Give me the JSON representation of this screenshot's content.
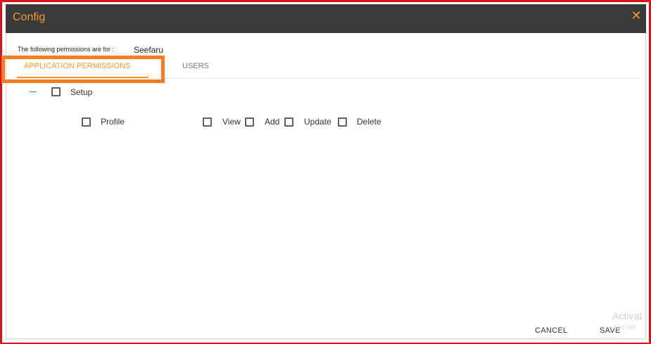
{
  "dialog": {
    "title": "Config",
    "close_icon_glyph": "✕",
    "accent_color": "#f29a33",
    "header_color": "#3a3a3a"
  },
  "permissions_for": {
    "label": "The following permissions are for :",
    "value": "Seefaru"
  },
  "tabs": [
    {
      "label": "APPLICATION PERMISSIONS",
      "active": true
    },
    {
      "label": "USERS",
      "active": false
    }
  ],
  "tree": {
    "group": {
      "label": "Setup",
      "expanded": true,
      "checked": false,
      "collapse_icon_glyph": "—"
    },
    "items": [
      {
        "label": "Profile",
        "checked": false,
        "actions": [
          {
            "label": "View",
            "checked": false
          },
          {
            "label": "Add",
            "checked": false
          },
          {
            "label": "Update",
            "checked": false
          },
          {
            "label": "Delete",
            "checked": false
          }
        ]
      }
    ]
  },
  "footer": {
    "cancel_label": "CANCEL",
    "save_label": "SAVE"
  },
  "watermark": {
    "line1": "Activat",
    "line2": "o to Set"
  },
  "highlight_color": "#ff7b22",
  "frame_color": "#e0101b"
}
